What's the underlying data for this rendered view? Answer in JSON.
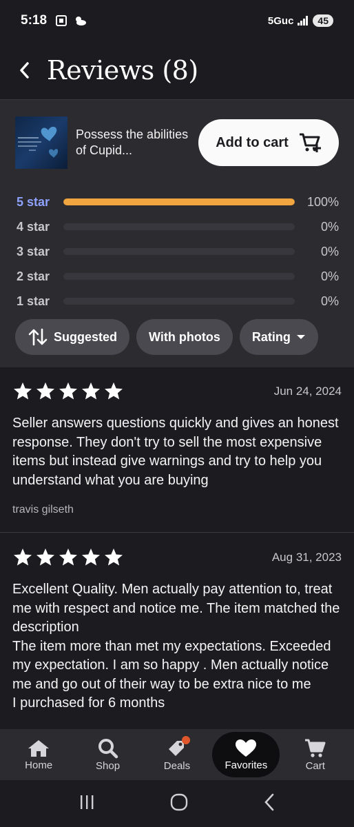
{
  "status_bar": {
    "time": "5:18",
    "network": "5Guc",
    "battery": "45"
  },
  "header": {
    "title": "Reviews (8)"
  },
  "product": {
    "name": "Possess the abilities of Cupid...",
    "add_to_cart_label": "Add to cart"
  },
  "rating_distribution": [
    {
      "label": "5 star",
      "percent_label": "100%",
      "fraction": 1.0,
      "active": true
    },
    {
      "label": "4 star",
      "percent_label": "0%",
      "fraction": 0.0,
      "active": false
    },
    {
      "label": "3 star",
      "percent_label": "0%",
      "fraction": 0.0,
      "active": false
    },
    {
      "label": "2 star",
      "percent_label": "0%",
      "fraction": 0.0,
      "active": false
    },
    {
      "label": "1 star",
      "percent_label": "0%",
      "fraction": 0.0,
      "active": false
    }
  ],
  "filters": {
    "suggested": "Suggested",
    "with_photos": "With photos",
    "rating": "Rating"
  },
  "reviews": [
    {
      "stars": 5,
      "date": "Jun 24, 2024",
      "text": "Seller answers questions quickly and gives an honest response. They don't try to sell the most expensive items but instead give warnings and try to help you understand what you are buying",
      "author": "travis gilseth"
    },
    {
      "stars": 5,
      "date": "Aug 31, 2023",
      "text": "Excellent Quality. Men actually pay attention to, treat me with respect and notice me. The item matched the description\nThe item more than met my expectations. Exceeded my expectation. I am so happy . Men actually notice me and go out of their way to be extra nice to me\nI purchased for 6 months",
      "author": ""
    }
  ],
  "bottom_nav": {
    "home": "Home",
    "shop": "Shop",
    "deals": "Deals",
    "favorites": "Favorites",
    "cart": "Cart",
    "active": "favorites"
  },
  "colors": {
    "background": "#1c1b1f",
    "accent_bar": "#f0a540",
    "active_star_label": "#8ea2ff",
    "deals_badge": "#e0572b"
  }
}
